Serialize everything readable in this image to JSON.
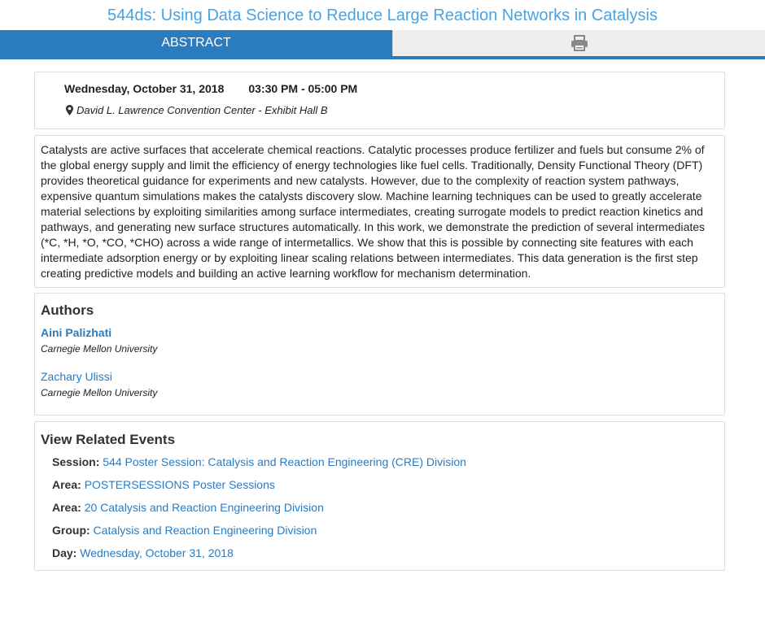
{
  "title": "544ds: Using Data Science to Reduce Large Reaction Networks in Catalysis",
  "tabs": {
    "abstract_label": "ABSTRACT",
    "print_icon": "printer-icon"
  },
  "schedule": {
    "date": "Wednesday, October 31, 2018",
    "time": "03:30 PM - 05:00 PM",
    "location": "David L. Lawrence Convention Center - Exhibit Hall B"
  },
  "abstract": {
    "lines": [
      "Catalysts are active surfaces that accelerate chemical reactions. Catalytic processes produce fertilizer and fuels but consume 2% of",
      "the global energy supply and limit the efficiency of energy technologies like fuel cells. Traditionally, Density Functional Theory (DFT)",
      "provides theoretical guidance for experiments and new catalysts. However, due to the complexity of reaction system pathways,",
      "expensive quantum simulations makes the catalysts discovery slow. Machine learning techniques can be used to greatly accelerate",
      "material selections by exploiting similarities among surface intermediates, creating surrogate models to predict reaction kinetics and",
      "pathways, and generating new surface structures automatically. In this work, we demonstrate the prediction of several intermediates",
      "(*C, *H, *O, *CO, *CHO) across a wide range of intermetallics. We show that this is possible by connecting site features with each",
      "intermediate adsorption energy or by exploiting linear scaling relations between intermediates. This data generation is the first step",
      "creating predictive models and building an active learning workflow for mechanism determination."
    ]
  },
  "authors": {
    "heading": "Authors",
    "list": [
      {
        "name": "Aini Palizhati",
        "affiliation": "Carnegie Mellon University"
      },
      {
        "name": "Zachary Ulissi",
        "affiliation": "Carnegie Mellon University"
      }
    ]
  },
  "related": {
    "heading": "View Related Events",
    "items": [
      {
        "label": "Session:",
        "value": "544 Poster Session: Catalysis and Reaction Engineering (CRE) Division"
      },
      {
        "label": "Area:",
        "value": "POSTERSESSIONS Poster Sessions"
      },
      {
        "label": "Area:",
        "value": "20 Catalysis and Reaction Engineering Division"
      },
      {
        "label": "Group:",
        "value": "Catalysis and Reaction Engineering Division"
      },
      {
        "label": "Day:",
        "value": "Wednesday, October 31, 2018"
      }
    ]
  },
  "colors": {
    "accent": "#2b7bbf",
    "title": "#4aa3df",
    "link": "#2b7bbf"
  }
}
